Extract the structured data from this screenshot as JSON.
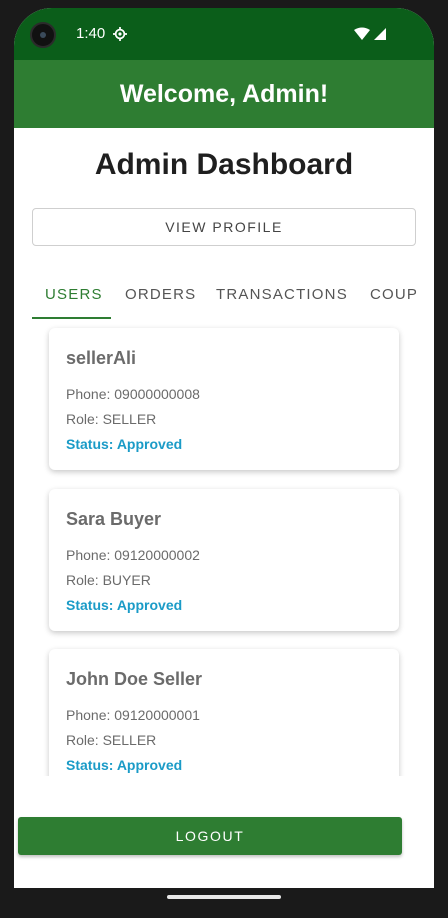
{
  "status_bar": {
    "time": "1:40",
    "icons": [
      "camera-icon",
      "settings-gear-icon",
      "wifi-icon",
      "signal-icon"
    ]
  },
  "app_bar": {
    "title": "Welcome, Admin!"
  },
  "page": {
    "title": "Admin Dashboard"
  },
  "profile_button": {
    "label": "VIEW PROFILE"
  },
  "tabs": [
    {
      "label": "USERS",
      "active": true
    },
    {
      "label": "ORDERS",
      "active": false
    },
    {
      "label": "TRANSACTIONS",
      "active": false
    },
    {
      "label": "COUP",
      "active": false
    }
  ],
  "users": [
    {
      "name": "sellerAli",
      "phone": "Phone: 09000000008",
      "role": "Role: SELLER",
      "status": "Status: Approved"
    },
    {
      "name": "Sara Buyer",
      "phone": "Phone: 09120000002",
      "role": "Role: BUYER",
      "status": "Status: Approved"
    },
    {
      "name": "John Doe Seller",
      "phone": "Phone: 09120000001",
      "role": "Role: SELLER",
      "status": "Status: Approved"
    }
  ],
  "logout_button": {
    "label": "LOGOUT"
  },
  "colors": {
    "status_bar": "#0b5e1a",
    "app_bar": "#2e7d32",
    "accent": "#2e7d32",
    "status_text": "#1a9bc7"
  }
}
